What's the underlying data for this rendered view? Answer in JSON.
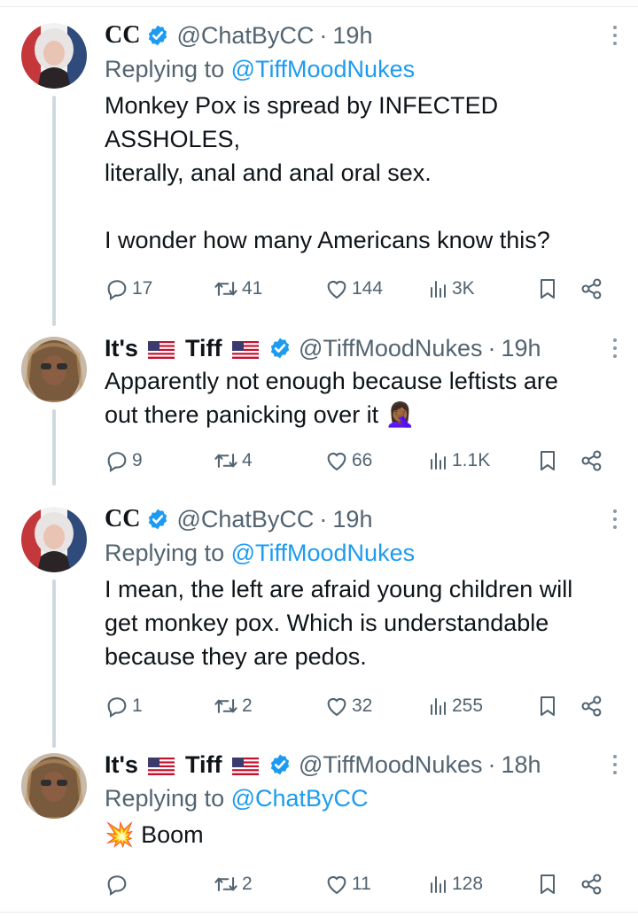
{
  "tweets": [
    {
      "name": "CC",
      "handle": "@ChatByCC",
      "time": "19h",
      "replying_prefix": "Replying to",
      "replying_to": "@TiffMoodNukes",
      "text": "Monkey Pox is spread by INFECTED\nASSHOLES,\nliterally, anal and anal oral sex.\n\nI wonder how many Americans know this?",
      "replies": "17",
      "reposts": "41",
      "likes": "144",
      "views": "3K"
    },
    {
      "name_part1": "It's",
      "name_part2": "Tiff",
      "handle": "@TiffMoodNukes",
      "time": "19h",
      "text": "Apparently not enough because leftists are\nout there panicking over it 🤦🏾‍♀️",
      "replies": "9",
      "reposts": "4",
      "likes": "66",
      "views": "1.1K"
    },
    {
      "name": "CC",
      "handle": "@ChatByCC",
      "time": "19h",
      "replying_prefix": "Replying to",
      "replying_to": "@TiffMoodNukes",
      "text": "I mean, the left are afraid young children will\nget monkey pox. Which is understandable\nbecause they are pedos.",
      "replies": "1",
      "reposts": "2",
      "likes": "32",
      "views": "255"
    },
    {
      "name_part1": "It's",
      "name_part2": "Tiff",
      "handle": "@TiffMoodNukes",
      "time": "18h",
      "replying_prefix": "Replying to",
      "replying_to": "@ChatByCC",
      "text": "💥 Boom",
      "replies": "",
      "reposts": "2",
      "likes": "11",
      "views": "128"
    }
  ],
  "dot": "·",
  "colors": {
    "text": "#0f1419",
    "secondary": "#536471",
    "link": "#1d9bf0",
    "thread_line": "#cfd9de"
  }
}
